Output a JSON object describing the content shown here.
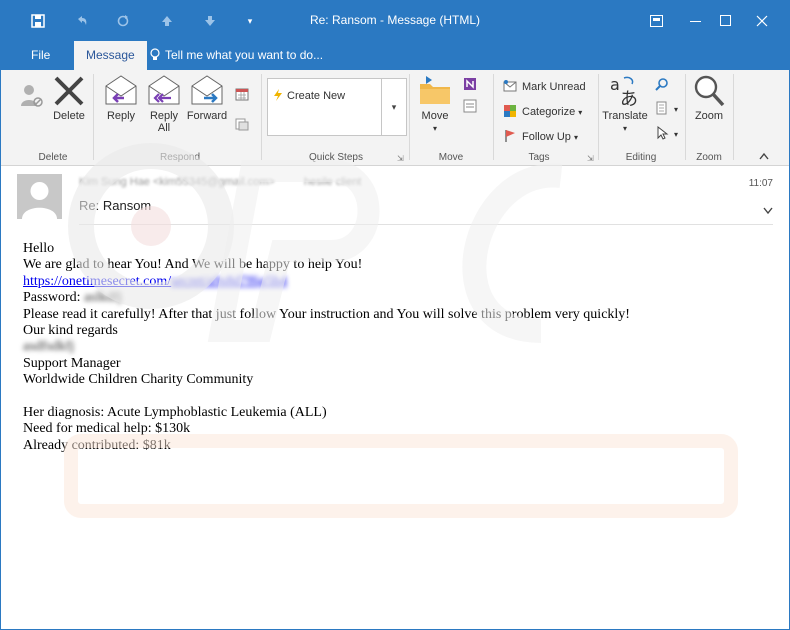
{
  "window": {
    "title": "Re: Ransom - Message (HTML)"
  },
  "qat": {
    "save": "save-icon",
    "undo": "undo-icon",
    "redo": "redo-icon",
    "up": "up-icon",
    "down": "down-icon",
    "more": "more-icon"
  },
  "tabs": [
    {
      "label": "File"
    },
    {
      "label": "Message"
    }
  ],
  "tell_me": "Tell me what you want to do...",
  "ribbon": {
    "delete": {
      "label": "Delete",
      "group": "Delete"
    },
    "respond": {
      "reply": "Reply",
      "reply_all_1": "Reply",
      "reply_all_2": "All",
      "forward": "Forward",
      "group": "Respond"
    },
    "quick_steps": {
      "create_new": "Create New",
      "group": "Quick Steps"
    },
    "move": {
      "label": "Move",
      "group": "Move"
    },
    "tags": {
      "mark_unread": "Mark Unread",
      "categorize": "Categorize",
      "follow_up": "Follow Up",
      "group": "Tags"
    },
    "editing": {
      "translate": "Translate",
      "group": "Editing"
    },
    "zoom": {
      "label": "Zoom",
      "group": "Zoom"
    }
  },
  "message": {
    "sender_blurred": "Kim Sung Hae <kim55345@gmail.com>",
    "recipient_blurred": "hesile client",
    "subject": "Re: Ransom",
    "time": "11:07"
  },
  "body": {
    "line1": "Hello",
    "line2": "We are glad to hear You! And We will be happy to help You!",
    "link_visible": "https://onetimesecret.com/",
    "link_blurred": "secret/a9s8d7f6g5h4",
    "password_label": "Password: ",
    "password_blurred": "aslkdfj",
    "line4": "Please read it carefully! After that just follow Your instruction and You will solve this problem very quickly!",
    "line5": "Our kind regards",
    "name_blurred": "asdfsdkfj",
    "line6": "Support Manager",
    "line7": "Worldwide Children Charity Community",
    "line8": "Her diagnosis: Acute Lymphoblastic Leukemia (ALL)",
    "line9": "Need for medical help: $130k",
    "line10": "Already contributed: $81k"
  }
}
